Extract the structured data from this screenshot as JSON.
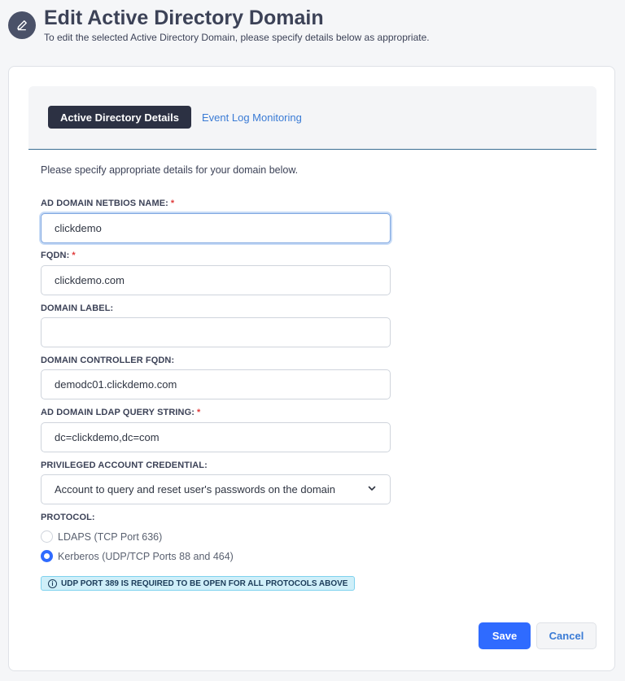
{
  "header": {
    "icon": "pencil-icon",
    "title": "Edit Active Directory Domain",
    "subtitle": "To edit the selected Active Directory Domain, please specify details below as appropriate."
  },
  "tabs": [
    {
      "label": "Active Directory Details",
      "active": true
    },
    {
      "label": "Event Log Monitoring",
      "active": false
    }
  ],
  "intro": "Please specify appropriate details for your domain below.",
  "fields": {
    "netbios": {
      "label": "AD DOMAIN NETBIOS NAME:",
      "required": "*",
      "value": "clickdemo"
    },
    "fqdn": {
      "label": "FQDN:",
      "required": "*",
      "value": "clickdemo.com"
    },
    "domain_label": {
      "label": "DOMAIN LABEL:",
      "value": ""
    },
    "dc_fqdn": {
      "label": "DOMAIN CONTROLLER FQDN:",
      "value": "demodc01.clickdemo.com"
    },
    "ldap_query": {
      "label": "AD DOMAIN LDAP QUERY STRING:",
      "required": "*",
      "value": "dc=clickdemo,dc=com"
    },
    "credential": {
      "label": "PRIVILEGED ACCOUNT CREDENTIAL:",
      "value": "Account to query and reset user's passwords on the domain"
    }
  },
  "protocol": {
    "label": "PROTOCOL:",
    "options": [
      {
        "label": "LDAPS (TCP Port 636)",
        "checked": false
      },
      {
        "label": "Kerberos (UDP/TCP Ports 88 and 464)",
        "checked": true
      }
    ]
  },
  "notice": "UDP PORT 389 IS REQUIRED TO BE OPEN FOR ALL PROTOCOLS ABOVE",
  "buttons": {
    "save": "Save",
    "cancel": "Cancel"
  },
  "colors": {
    "primary": "#2f6bff",
    "dark_tab": "#2c3143",
    "required": "#e03b3b",
    "info_bg": "#cfeff9"
  }
}
